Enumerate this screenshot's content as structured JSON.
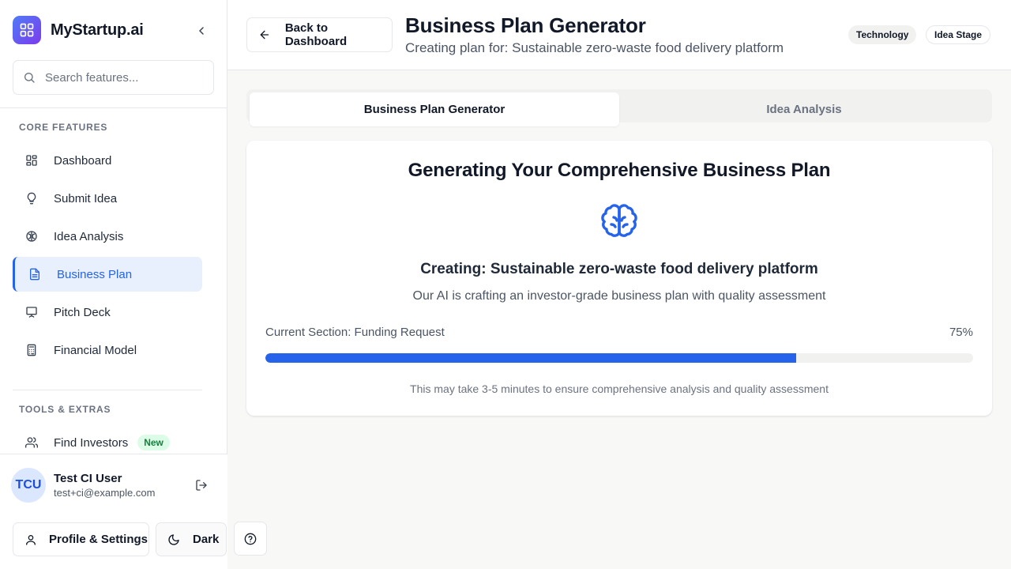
{
  "app": {
    "name": "MyStartup.ai",
    "logo_icon": "grid-icon"
  },
  "sidebar": {
    "search_placeholder": "Search features...",
    "core_label": "CORE FEATURES",
    "core_items": [
      {
        "label": "Dashboard",
        "icon": "dashboard-icon",
        "active": false
      },
      {
        "label": "Submit Idea",
        "icon": "lightbulb-icon",
        "active": false
      },
      {
        "label": "Idea Analysis",
        "icon": "brain-icon",
        "active": false
      },
      {
        "label": "Business Plan",
        "icon": "document-icon",
        "active": true
      },
      {
        "label": "Pitch Deck",
        "icon": "presentation-icon",
        "active": false
      },
      {
        "label": "Financial Model",
        "icon": "calculator-icon",
        "active": false
      }
    ],
    "tools_label": "TOOLS & EXTRAS",
    "tools_items": [
      {
        "label": "Find Investors",
        "icon": "users-icon",
        "badge": "New"
      }
    ],
    "user": {
      "initials": "TCU",
      "name": "Test CI User",
      "email": "test+ci@example.com"
    },
    "profile_label": "Profile & Settings",
    "theme_label": "Dark"
  },
  "header": {
    "back_label": "Back to Dashboard",
    "title": "Business Plan Generator",
    "subtitle": "Creating plan for: Sustainable zero-waste food delivery platform",
    "tags": [
      "Technology",
      "Idea Stage"
    ]
  },
  "tabs": [
    {
      "label": "Business Plan Generator",
      "active": true
    },
    {
      "label": "Idea Analysis",
      "active": false
    }
  ],
  "card": {
    "title": "Generating Your Comprehensive Business Plan",
    "creating": "Creating: Sustainable zero-waste food delivery platform",
    "description": "Our AI is crafting an investor-grade business plan with quality assessment",
    "current_section": "Current Section: Funding Request",
    "progress_label": "75%",
    "progress_value": 0.75,
    "hint": "This may take 3-5 minutes to ensure comprehensive analysis and quality assessment"
  },
  "colors": {
    "accent": "#2563eb",
    "active_nav_bg": "#e8f0fe",
    "badge_green": "#15803d"
  }
}
